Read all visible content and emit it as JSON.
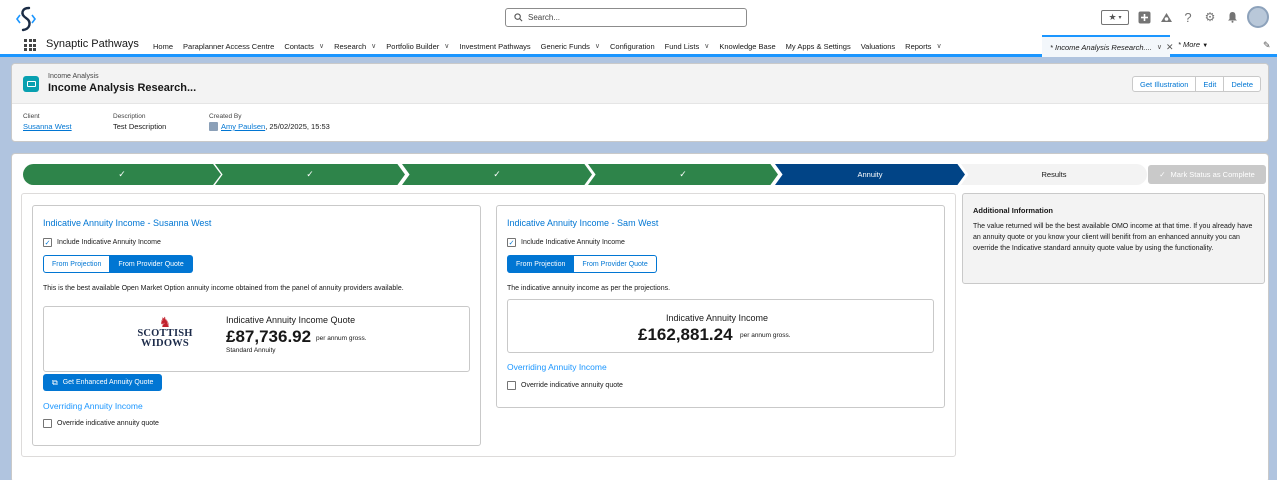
{
  "header": {
    "search_placeholder": "Search...",
    "icons": [
      "favorites-star-icon",
      "favorites-dropdown-icon",
      "global-actions-icon",
      "trailhead-icon",
      "help-icon",
      "setup-gear-icon",
      "notifications-bell-icon",
      "avatar"
    ]
  },
  "nav": {
    "app_name": "Synaptic Pathways",
    "items": [
      {
        "label": "Home",
        "dropdown": false
      },
      {
        "label": "Paraplanner Access Centre",
        "dropdown": false
      },
      {
        "label": "Contacts",
        "dropdown": true
      },
      {
        "label": "Research",
        "dropdown": true
      },
      {
        "label": "Portfolio Builder",
        "dropdown": true
      },
      {
        "label": "Investment Pathways",
        "dropdown": false
      },
      {
        "label": "Generic Funds",
        "dropdown": true
      },
      {
        "label": "Configuration",
        "dropdown": false
      },
      {
        "label": "Fund Lists",
        "dropdown": true
      },
      {
        "label": "Knowledge Base",
        "dropdown": false
      },
      {
        "label": "My Apps & Settings",
        "dropdown": false
      },
      {
        "label": "Valuations",
        "dropdown": false
      },
      {
        "label": "Reports",
        "dropdown": true
      }
    ],
    "active_tab": "* Income Analysis Research....",
    "more": "* More"
  },
  "record": {
    "object_type": "Income Analysis",
    "title": "Income Analysis Research...",
    "buttons": [
      "Get Illustration",
      "Edit",
      "Delete"
    ],
    "fields": {
      "client_label": "Client",
      "client_value": "Susanna West",
      "description_label": "Description",
      "description_value": "Test Description",
      "created_by_label": "Created By",
      "created_by_user": "Amy Paulsen",
      "created_by_date": ", 25/02/2025, 15:53"
    }
  },
  "path": {
    "steps": [
      {
        "label": "✓",
        "status": "complete"
      },
      {
        "label": "✓",
        "status": "complete"
      },
      {
        "label": "✓",
        "status": "complete"
      },
      {
        "label": "✓",
        "status": "complete"
      },
      {
        "label": "Annuity",
        "status": "current"
      },
      {
        "label": "Results",
        "status": "incomplete"
      }
    ],
    "mark_complete": "Mark Status as Complete"
  },
  "left_panel": {
    "title": "Indicative Annuity Income - Susanna West",
    "include_label": "Include Indicative Annuity Income",
    "include_checked": true,
    "toggle_projection": "From Projection",
    "toggle_provider": "From Provider Quote",
    "selected": "From Provider Quote",
    "description": "This is the best available Open Market Option annuity income obtained from the panel of annuity providers available.",
    "provider_logo_line1": "SCOTTISH",
    "provider_logo_line2": "WIDOWS",
    "quote_title": "Indicative Annuity Income Quote",
    "amount": "£87,736.92",
    "amount_suffix": "per annum gross.",
    "annuity_type": "Standard Annuity",
    "enhanced_button": "Get Enhanced Annuity Quote",
    "overriding_title": "Overriding Annuity Income",
    "override_label": "Override indicative annuity quote",
    "override_checked": false
  },
  "right_panel": {
    "title": "Indicative Annuity Income - Sam West",
    "include_label": "Include Indicative Annuity Income",
    "include_checked": true,
    "toggle_projection": "From Projection",
    "toggle_provider": "From Provider Quote",
    "selected": "From Projection",
    "description": "The indicative annuity income as per the projections.",
    "quote_title": "Indicative Annuity Income",
    "amount": "£162,881.24",
    "amount_suffix": "per annum gross.",
    "overriding_title": "Overriding Annuity Income",
    "override_label": "Override indicative annuity quote",
    "override_checked": false
  },
  "info": {
    "title": "Additional Information",
    "body": "The value returned will be the best available OMO income at that time. If you already have an annuity quote or you know your client will benifit from an enhanced annuity you can override the Indicative standard annuity quote value by using the functionality."
  },
  "colors": {
    "brand_blue": "#0176d3",
    "path_complete": "#2e844a",
    "path_current": "#014486",
    "page_background": "#b0c4df"
  }
}
